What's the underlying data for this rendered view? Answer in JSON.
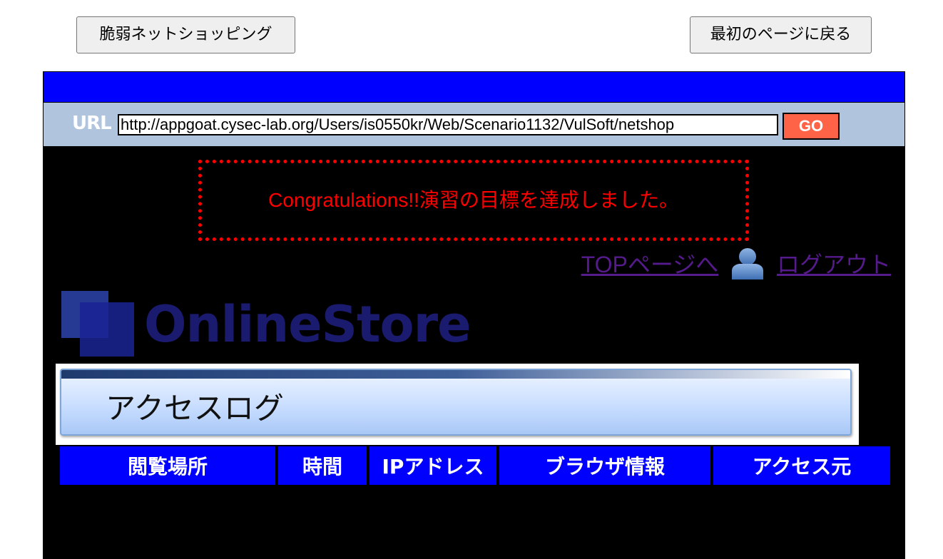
{
  "top_buttons": {
    "app_name": "脆弱ネットショッピング",
    "back_to_first": "最初のページに戻る"
  },
  "url_bar": {
    "label": "URL",
    "value": "http://appgoat.cysec-lab.org/Users/is0550kr/Web/Scenario1132/VulSoft/netshop",
    "go_label": "GO"
  },
  "message": {
    "congrats": "Congratulations!!演習の目標を達成しました。"
  },
  "nav": {
    "top_link": "TOPページへ",
    "user_icon": "user-icon",
    "logout_link": "ログアウト"
  },
  "logo": {
    "text": "OnlineStore"
  },
  "section": {
    "title": "アクセスログ"
  },
  "table": {
    "headers": [
      "閲覧場所",
      "時間",
      "IPアドレス",
      "ブラウザ情報",
      "アクセス元"
    ]
  },
  "colors": {
    "blue_bar": "#0000ff",
    "url_bar_bg": "#b0c4de",
    "go_button": "#ff6347",
    "congrats_text": "#ff0000",
    "link": "#551a8b"
  }
}
